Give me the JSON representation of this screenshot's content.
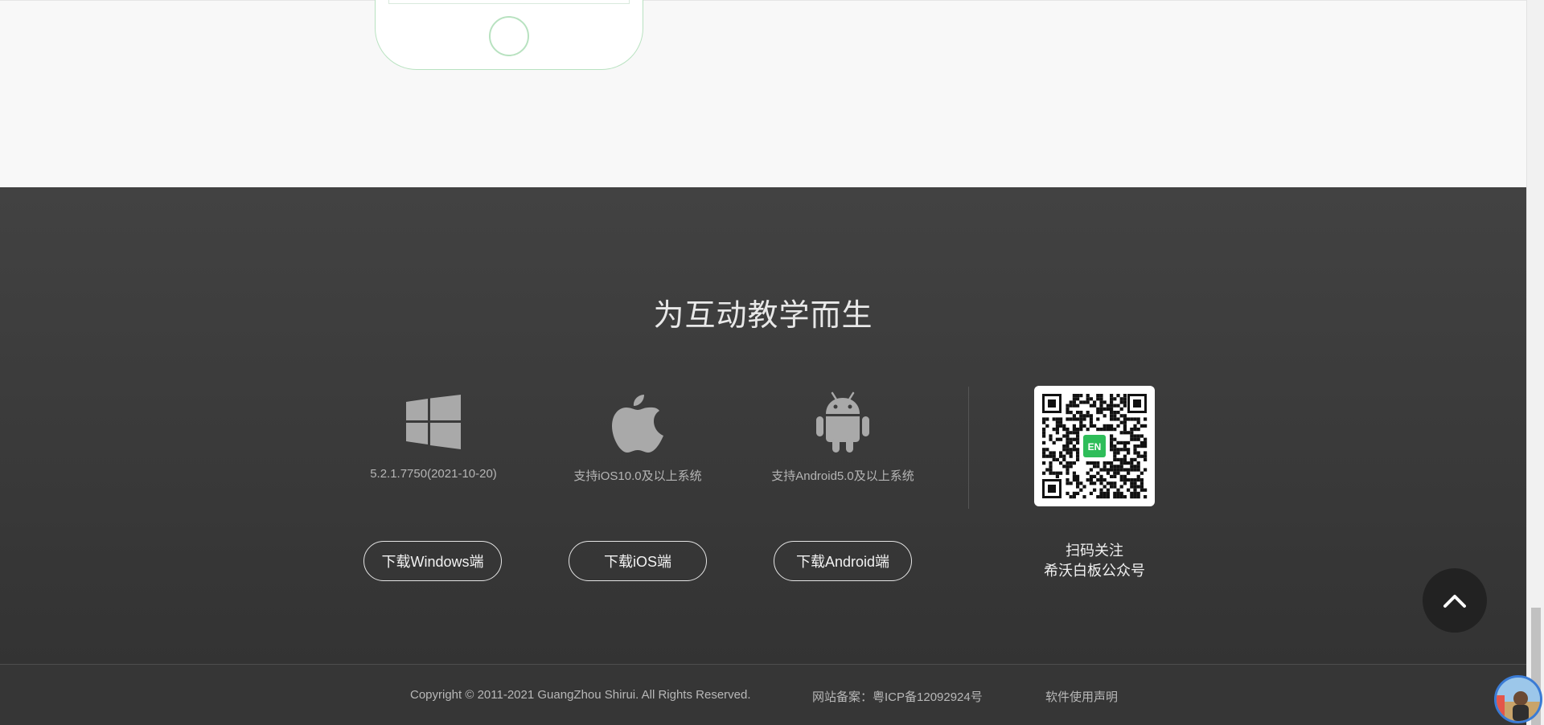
{
  "hero": {
    "headline": "为互动教学而生"
  },
  "platforms": [
    {
      "icon": "windows-icon",
      "requirement": "5.2.1.7750(2021-10-20)",
      "button_label": "下载Windows端"
    },
    {
      "icon": "apple-icon",
      "requirement": "支持iOS10.0及以上系统",
      "button_label": "下载iOS端"
    },
    {
      "icon": "android-icon",
      "requirement": "支持Android5.0及以上系统",
      "button_label": "下载Android端"
    }
  ],
  "qr": {
    "badge": "EN",
    "caption_line1": "扫码关注",
    "caption_line2": "希沃白板公众号"
  },
  "footer": {
    "copyright": "Copyright © 2011-2021 GuangZhou Shirui. All Rights Reserved.",
    "icp": "网站备案：粤ICP备12092924号",
    "software_notice": "软件使用声明"
  },
  "colors": {
    "footer_bg": "#3a3a3a",
    "qr_badge": "#2ebd59",
    "phone_outline": "#b8e2c0"
  }
}
